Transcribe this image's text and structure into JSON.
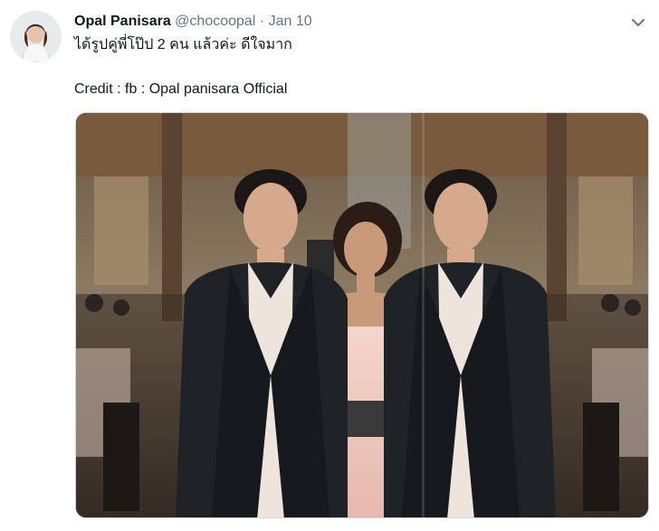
{
  "tweet": {
    "author_name": "Opal Panisara",
    "handle": "@chocoopal",
    "separator": "·",
    "date": "Jan 10",
    "text_line1": "ได้รูปคู่พี่โป๊ป 2 คน แล้วค่ะ ดีใจมาก",
    "text_line2": "Credit : fb : Opal panisara Official"
  },
  "icons": {
    "more": "chevron-down-icon"
  },
  "colors": {
    "name": "#14171a",
    "secondary": "#657786",
    "accent": "#1da1f2"
  }
}
